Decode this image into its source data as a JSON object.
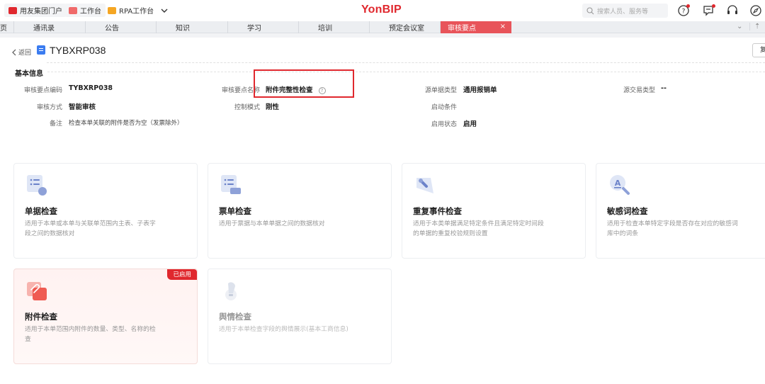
{
  "topbar": {
    "portal_label": "用友集团门户",
    "workbench_label": "工作台",
    "rpa_label": "RPA工作台",
    "brand": "YonBIP",
    "search_placeholder": "搜索人员、服务等",
    "colors": {
      "brand": "#e0282e",
      "accent": "#e8545a"
    }
  },
  "tabs": {
    "partial_left": "页",
    "items": [
      "通讯录",
      "公告",
      "知识",
      "学习",
      "培训",
      "预定会议室"
    ],
    "active": "审核要点",
    "close": "×",
    "more": "⌄"
  },
  "page": {
    "back_label": "返回",
    "title": "TYBXRP038",
    "right_button_partial": "复",
    "section_title": "基本信息",
    "fields": {
      "code_label": "审核要点编码",
      "code_value": "TYBXRP038",
      "name_label": "审核要点名称",
      "name_value": "附件完整性检查",
      "source_type_label": "源单据类型",
      "source_type_value": "通用报销单",
      "source_trans_label": "源交易类型",
      "source_trans_value": "--",
      "method_label": "审核方式",
      "method_value": "智能审核",
      "control_label": "控制模式",
      "control_value": "刚性",
      "start_cond_label": "启动条件",
      "start_cond_value": "",
      "remark_label": "备注",
      "remark_value": "检查本单关联的附件是否为空（发票除外）",
      "status_label": "启用状态",
      "status_value": "启用"
    }
  },
  "cards": [
    {
      "title": "单据检查",
      "desc": "适用于本单或本单与关联单范围内主表、子表字段之间的数据核对",
      "icon": "document-list-icon"
    },
    {
      "title": "票单检查",
      "desc": "适用于票据与本单单据之间的数据核对",
      "icon": "invoice-list-icon"
    },
    {
      "title": "重复事件检查",
      "desc": "适用于本类单据满足特定条件且满足特定时间段的单据的重复校验规则设置",
      "icon": "repeat-tool-icon"
    },
    {
      "title": "敏感词检查",
      "desc": "适用于检查本单特定字段是否存在对应的敏感词库中的词条",
      "icon": "sensitive-word-search-icon"
    },
    {
      "title": "附件检查",
      "desc": "适用于本单范围内附件的数量、类型、名称的检查",
      "icon": "attachment-icon",
      "badge": "已启用"
    },
    {
      "title": "舆情检查",
      "desc": "适用于本单检查字段的舆情展示(基本工商信息)",
      "icon": "public-opinion-icon"
    }
  ]
}
